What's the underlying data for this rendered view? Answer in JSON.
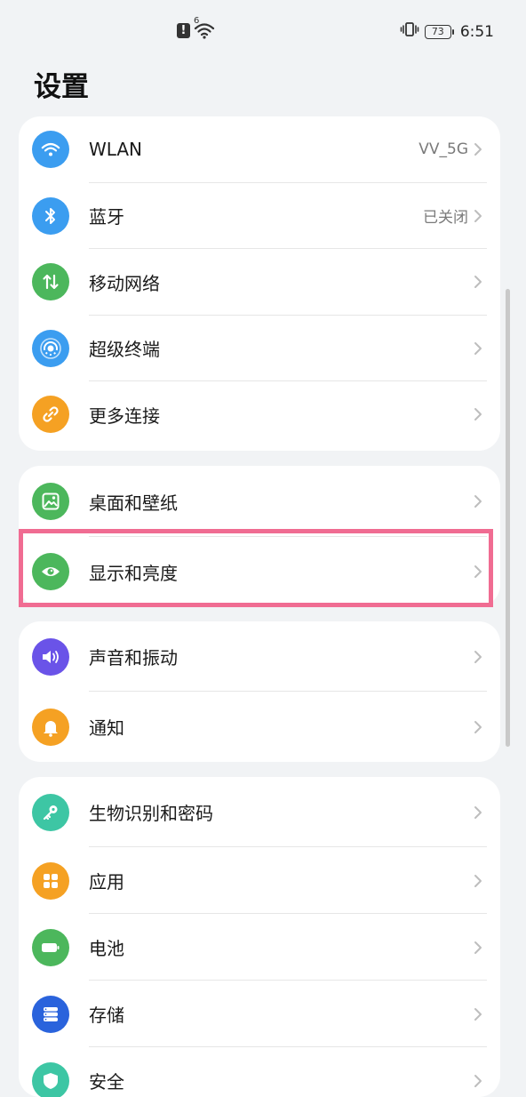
{
  "status_bar": {
    "network_type": "6",
    "battery": "73",
    "time": "6:51"
  },
  "page": {
    "title": "设置"
  },
  "colors": {
    "wlan": "#3b9df0",
    "bluetooth": "#3b9df0",
    "mobile": "#4cb75c",
    "super": "#3b9df0",
    "more": "#f5a123",
    "wallpaper": "#4cb75c",
    "display": "#4cb75c",
    "sound": "#6a53e8",
    "notify": "#f5a123",
    "bio": "#3dc6a4",
    "apps": "#f5a123",
    "battery": "#4cb75c",
    "storage": "#2a63dc",
    "security": "#3dc6a4"
  },
  "groups": {
    "connect": [
      {
        "label": "WLAN",
        "value": "VV_5G",
        "icon": "wifi-icon"
      },
      {
        "label": "蓝牙",
        "value": "已关闭",
        "icon": "bluetooth-icon"
      },
      {
        "label": "移动网络",
        "value": "",
        "icon": "mobile-data-icon"
      },
      {
        "label": "超级终端",
        "value": "",
        "icon": "super-device-icon"
      },
      {
        "label": "更多连接",
        "value": "",
        "icon": "link-icon"
      }
    ],
    "display": [
      {
        "label": "桌面和壁纸",
        "icon": "wallpaper-icon"
      },
      {
        "label": "显示和亮度",
        "icon": "eye-icon"
      }
    ],
    "sound": [
      {
        "label": "声音和振动",
        "icon": "speaker-icon"
      },
      {
        "label": "通知",
        "icon": "bell-icon"
      }
    ],
    "system": [
      {
        "label": "生物识别和密码",
        "icon": "key-icon"
      },
      {
        "label": "应用",
        "icon": "apps-icon"
      },
      {
        "label": "电池",
        "icon": "battery-icon"
      },
      {
        "label": "存储",
        "icon": "storage-icon"
      },
      {
        "label": "安全",
        "icon": "shield-icon"
      }
    ]
  }
}
